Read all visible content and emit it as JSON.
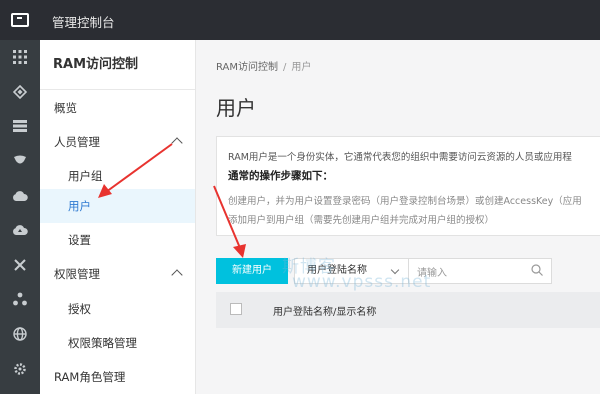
{
  "topbar": {
    "console_title": "管理控制台"
  },
  "iconbar": {
    "icons": [
      "apps-grid-icon",
      "layers-icon",
      "server-icon",
      "shield-icon",
      "cloud-icon",
      "cloud-upload-icon",
      "network-icon",
      "share-icon",
      "globe-icon",
      "gear-icon"
    ]
  },
  "sidebar": {
    "title": "RAM访问控制",
    "items": [
      {
        "label": "概览",
        "level": 1
      },
      {
        "label": "人员管理",
        "level": 1,
        "expanded": true
      },
      {
        "label": "用户组",
        "level": 2
      },
      {
        "label": "用户",
        "level": 2,
        "active": true
      },
      {
        "label": "设置",
        "level": 2
      },
      {
        "label": "权限管理",
        "level": 1,
        "expanded": true
      },
      {
        "label": "授权",
        "level": 2
      },
      {
        "label": "权限策略管理",
        "level": 2
      },
      {
        "label": "RAM角色管理",
        "level": 1
      }
    ]
  },
  "breadcrumb": {
    "root": "RAM访问控制",
    "separator": "/",
    "current": "用户"
  },
  "page": {
    "title": "用户"
  },
  "info": {
    "line1": "RAM用户是一个身份实体，它通常代表您的组织中需要访问云资源的人员或应用程",
    "line2": "通常的操作步骤如下：",
    "line3": "创建用户，并为用户设置登录密码（用户登录控制台场景）或创建AccessKey（应用",
    "line4": "添加用户到用户组（需要先创建用户组并完成对用户组的授权）"
  },
  "toolbar": {
    "new_user_label": "新建用户",
    "search_field_option": "用户登陆名称",
    "search_placeholder": "请输入"
  },
  "table": {
    "headers": [
      "用户登陆名称/显示名称"
    ]
  },
  "watermark": {
    "line1": "斯博客",
    "line2": "www.vpsss.net"
  },
  "colors": {
    "accent": "#00c1de",
    "annotation_arrow": "#e8332f",
    "active_link": "#2f7ad1",
    "topbar": "#2b2d33",
    "iconbar": "#373d41"
  }
}
